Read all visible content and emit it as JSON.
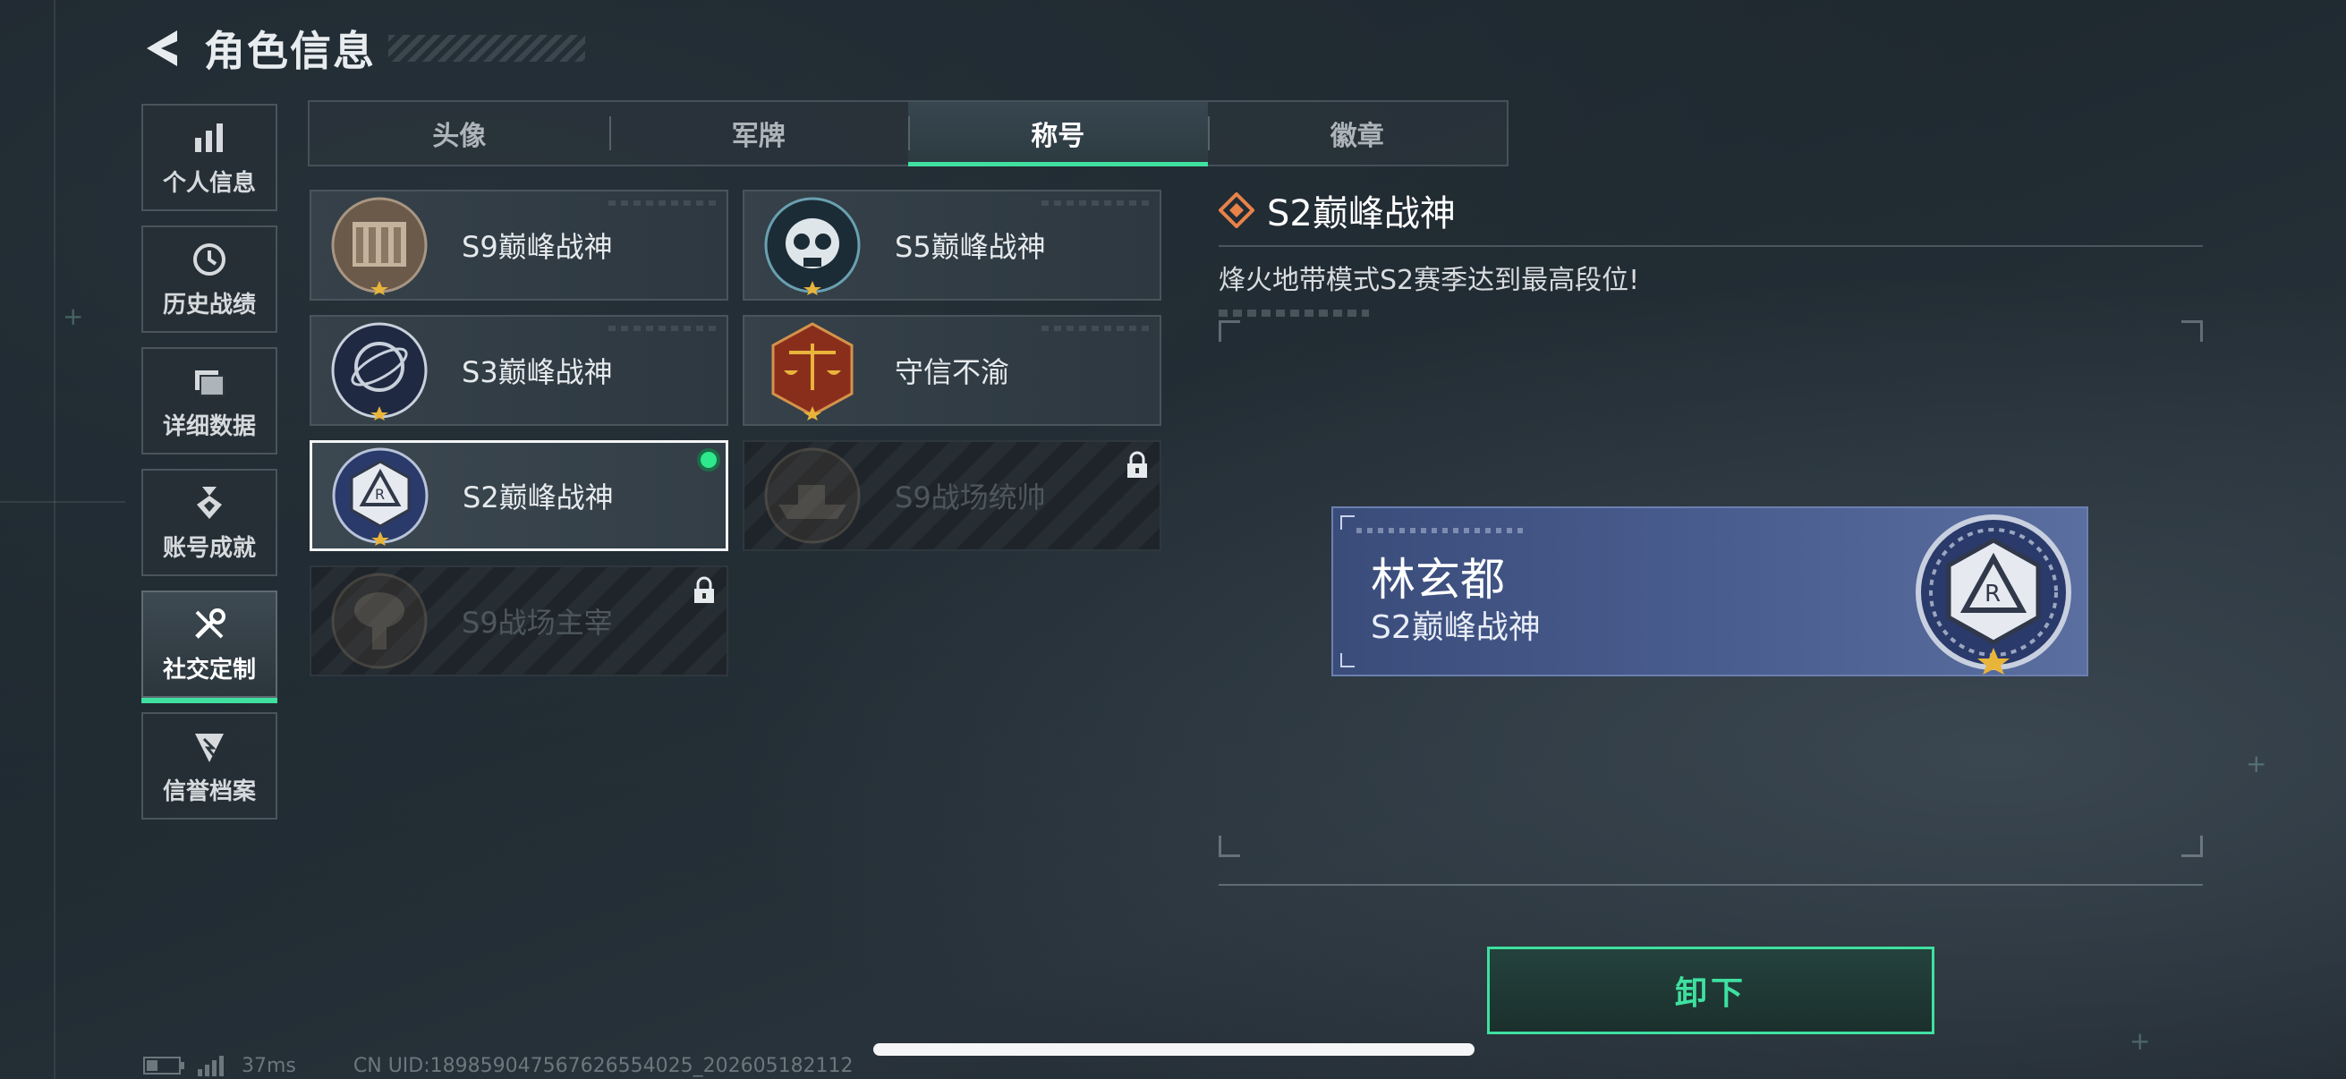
{
  "header": {
    "title": "角色信息"
  },
  "sidebar": {
    "items": [
      {
        "label": "个人信息",
        "icon": "bar-chart-icon"
      },
      {
        "label": "历史战绩",
        "icon": "history-icon"
      },
      {
        "label": "详细数据",
        "icon": "folder-icon"
      },
      {
        "label": "账号成就",
        "icon": "achievement-icon"
      },
      {
        "label": "社交定制",
        "icon": "tools-icon",
        "active": true
      },
      {
        "label": "信誉档案",
        "icon": "credit-icon"
      }
    ]
  },
  "tabs": [
    {
      "label": "头像"
    },
    {
      "label": "军牌"
    },
    {
      "label": "称号",
      "active": true
    },
    {
      "label": "徽章"
    }
  ],
  "titles": [
    {
      "name": "S9巅峰战神",
      "medal": "monument-medal-icon",
      "state": "owned"
    },
    {
      "name": "S5巅峰战神",
      "medal": "skull-medal-icon",
      "state": "owned"
    },
    {
      "name": "S3巅峰战神",
      "medal": "globe-medal-icon",
      "state": "owned"
    },
    {
      "name": "守信不渝",
      "medal": "scales-medal-icon",
      "state": "owned"
    },
    {
      "name": "S2巅峰战神",
      "medal": "hexagon-medal-icon",
      "state": "equipped"
    },
    {
      "name": "S9战场统帅",
      "medal": "ship-medal-icon",
      "state": "locked"
    },
    {
      "name": "S9战场主宰",
      "medal": "explosion-medal-icon",
      "state": "locked"
    }
  ],
  "detail": {
    "title": "S2巅峰战神",
    "description": "烽火地带模式S2赛季达到最高段位!"
  },
  "nameplate": {
    "player": "林玄都",
    "title": "S2巅峰战神"
  },
  "actions": {
    "unequip_label": "卸下"
  },
  "status": {
    "ping": "37ms",
    "uid": "CN UID:189859047567626554025_202605182112"
  },
  "colors": {
    "accent": "#3fe0a0",
    "equipped_dot": "#2ee88c",
    "nameplate": "#4a5e90",
    "detail_icon": "#e8824a"
  }
}
